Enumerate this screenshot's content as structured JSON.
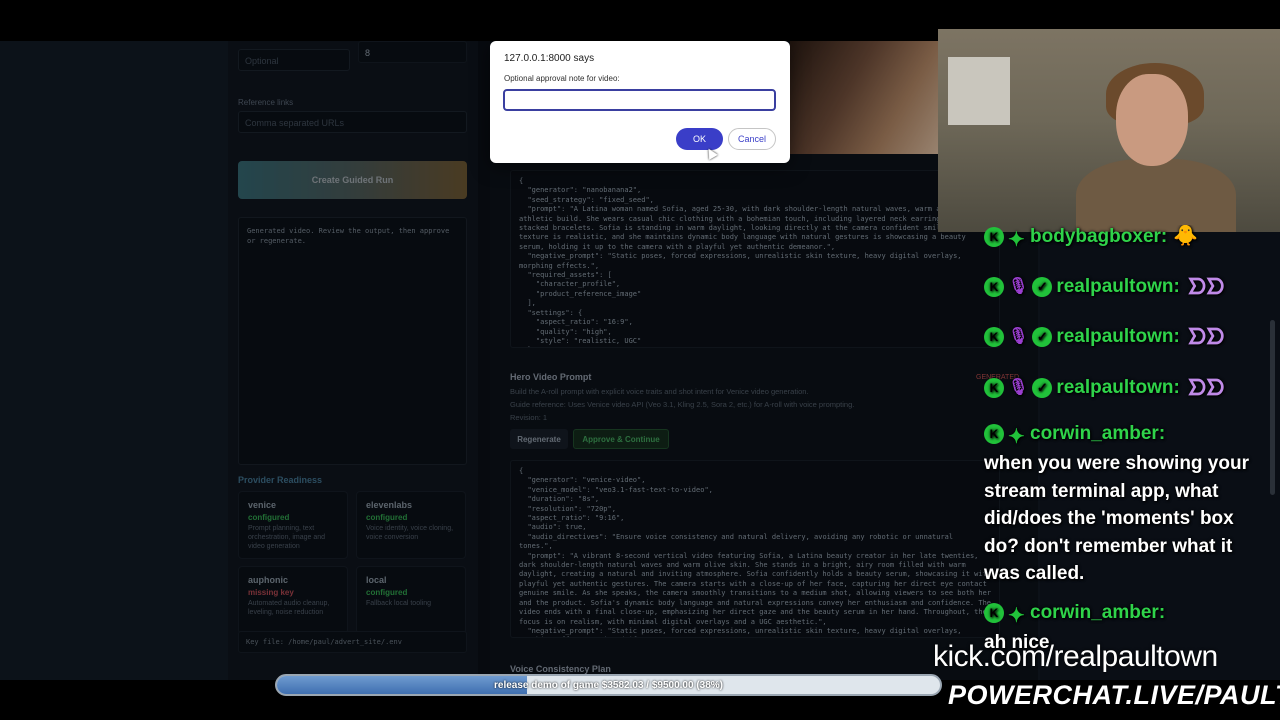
{
  "form": {
    "field_a_placeholder": "Optional",
    "field_b_value": "8",
    "reference_links_label": "Reference links",
    "reference_links_placeholder": "Comma separated URLs",
    "create_button": "Create Guided Run",
    "output_text": "Generated video. Review the output, then approve or regenerate."
  },
  "providers": {
    "title": "Provider Readiness",
    "items": [
      {
        "name": "venice",
        "status": "configured",
        "status_color": "#2f9a4a",
        "desc": "Prompt planning, text orchestration, image and video generation"
      },
      {
        "name": "elevenlabs",
        "status": "configured",
        "status_color": "#2f9a4a",
        "desc": "Voice identity, voice cloning, voice conversion"
      },
      {
        "name": "auphonic",
        "status": "missing key",
        "status_color": "#a8454d",
        "desc": "Automated audio cleanup, leveling, noise reduction"
      },
      {
        "name": "local",
        "status": "configured",
        "status_color": "#2f9a4a",
        "desc": "Fallback local tooling"
      }
    ],
    "key_file": "Key file: /home/paul/advert_site/.env"
  },
  "image_json": "{\n  \"generator\": \"nanobanana2\",\n  \"seed_strategy\": \"fixed_seed\",\n  \"prompt\": \"A Latina woman named Sofia, aged 25-30, with dark shoulder-length natural waves, warm and an athletic build. She wears casual chic clothing with a bohemian touch, including layered neck earrings, and stacked bracelets. Sofia is standing in warm daylight, looking directly at the camera confident smile. Her skin texture is realistic, and she maintains dynamic body language with natural gestures is showcasing a beauty serum, holding it up to the camera with a playful yet authentic demeanor.\",\n  \"negative_prompt\": \"Static poses, forced expressions, unrealistic skin texture, heavy digital overlays, morphing effects.\",\n  \"required_assets\": [\n    \"character_profile\",\n    \"product_reference_image\"\n  ],\n  \"settings\": {\n    \"aspect_ratio\": \"16:9\",\n    \"quality\": \"high\",\n    \"style\": \"realistic, UGC\"\n  }",
  "hero": {
    "title": "Hero Video Prompt",
    "desc1": "Build the A-roll prompt with explicit voice traits and shot intent for Venice video generation.",
    "desc2": "Guide reference: Uses Venice video API (Veo 3.1, Kling 2.5, Sora 2, etc.) for A-roll with voice prompting.",
    "revision": "Revision: 1",
    "regenerate": "Regenerate",
    "approve": "Approve & Continue",
    "badge": "GENERATED",
    "json": "{\n  \"generator\": \"venice-video\",\n  \"venice_model\": \"veo3.1-fast-text-to-video\",\n  \"duration\": \"8s\",\n  \"resolution\": \"720p\",\n  \"aspect_ratio\": \"9:16\",\n  \"audio\": true,\n  \"audio_directives\": \"Ensure voice consistency and natural delivery, avoiding any robotic or unnatural tones.\",\n  \"prompt\": \"A vibrant 8-second vertical video featuring Sofia, a Latina beauty creator in her late twenties, dark shoulder-length natural waves and warm olive skin. She stands in a bright, airy room filled with warm daylight, creating a natural and inviting atmosphere. Sofia confidently holds a beauty serum, showcasing it with playful yet authentic gestures. The camera starts with a close-up of her face, capturing her direct eye contact genuine smile. As she speaks, the camera smoothly transitions to a medium shot, allowing viewers to see both her and the product. Sofia's dynamic body language and natural expressions convey her enthusiasm and confidence. The video ends with a final close-up, emphasizing her direct gaze and the beauty serum in her hand. Throughout, the focus is on realism, with minimal digital overlays and a UGC aesthetic.\",\n  \"negative_prompt\": \"Static poses, forced expressions, unrealistic skin texture, heavy digital overlays, morphing effects, voice drift.\",\n  \"voice_traits\": \"Warm voice from ElevenLabs, authentic, playful, confident, with a warm and engaging tone"
  },
  "next_section": "Voice Consistency Plan",
  "dialog": {
    "title": "127.0.0.1:8000 says",
    "message": "Optional approval note for video:",
    "input_value": "",
    "ok": "OK",
    "cancel": "Cancel"
  },
  "chat": {
    "messages": [
      {
        "user": "bodybagboxer:",
        "emote": "🐥"
      },
      {
        "user": "realpaultown:",
        "emote": "ᗤᗤ"
      },
      {
        "user": "realpaultown:",
        "emote": "ᗤᗤ"
      },
      {
        "user": "realpaultown:",
        "emote": "ᗤᗤ"
      },
      {
        "user": "corwin_amber:",
        "text": "when you were showing your stream terminal app, what did/does the 'moments' box do? don't remember what it was called."
      },
      {
        "user": "corwin_amber:",
        "text": "ah nice"
      }
    ]
  },
  "overlay": {
    "kick_url": "kick.com/realpaultown",
    "powerchat": "POWERCHAT.LIVE/PAULTOWN",
    "goal_text": "release demo of game $3582.03 / $9500.00 (38%)",
    "goal_fraction": 0.377
  }
}
